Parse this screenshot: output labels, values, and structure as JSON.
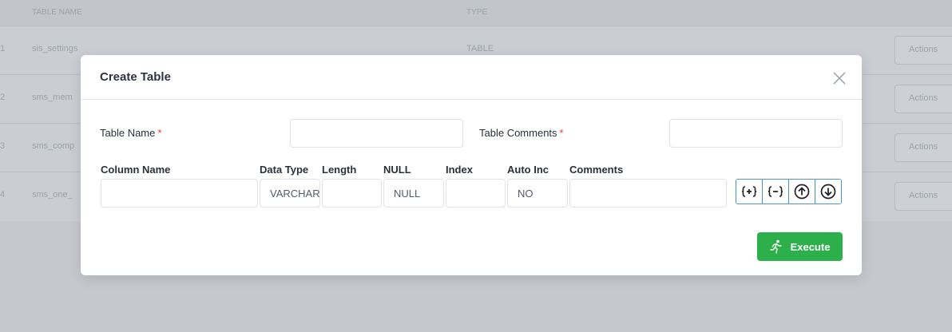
{
  "background": {
    "header": {
      "col1": "",
      "col2": "TABLE NAME",
      "col3": "TYPE"
    },
    "rows": [
      {
        "num": "1",
        "name": "sis_settings",
        "type": "TABLE",
        "actions": "Actions"
      },
      {
        "num": "2",
        "name": "sms_mem",
        "type": "",
        "actions": "Actions"
      },
      {
        "num": "3",
        "name": "sms_comp",
        "type": "",
        "actions": "Actions"
      },
      {
        "num": "4",
        "name": "sms_one_",
        "type": "",
        "actions": "Actions"
      }
    ]
  },
  "modal": {
    "title": "Create Table",
    "table_name_label": "Table Name",
    "table_comments_label": "Table Comments",
    "required_mark": "*",
    "table_name_value": "",
    "table_comments_value": "",
    "columns": {
      "headers": {
        "column_name": "Column Name",
        "data_type": "Data Type",
        "length": "Length",
        "null": "NULL",
        "index": "Index",
        "auto_inc": "Auto Inc",
        "comments": "Comments"
      },
      "row": {
        "column_name": "",
        "data_type": "VARCHAR",
        "length": "",
        "null": "NULL",
        "index": "",
        "auto_inc": "NO",
        "comments": ""
      }
    },
    "row_buttons": [
      "add-row-icon",
      "remove-row-icon",
      "arrow-up-icon",
      "arrow-down-icon"
    ],
    "execute_label": "Execute"
  },
  "colors": {
    "accent_green": "#2db04b",
    "button_border": "#4d93c8",
    "required": "#e53935"
  }
}
